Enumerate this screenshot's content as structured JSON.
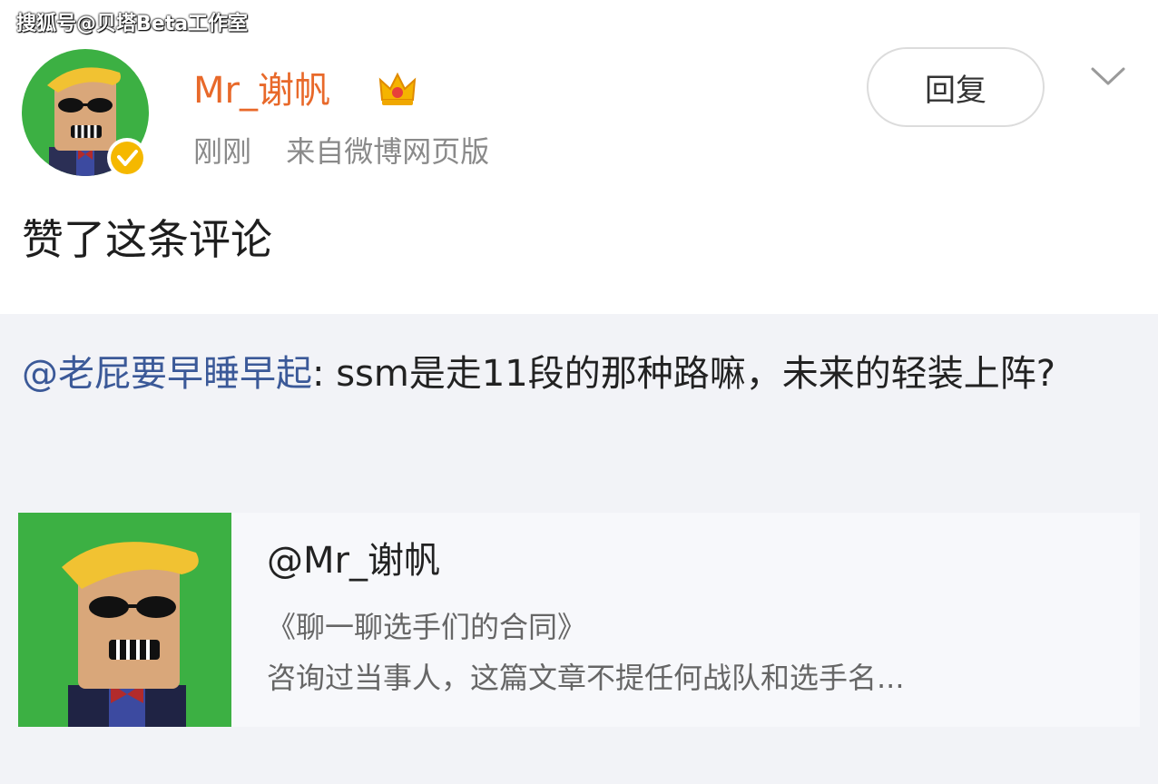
{
  "watermark": "搜狐号@贝塔Beta工作室",
  "post": {
    "username": "Mr_谢帆",
    "time": "刚刚",
    "source": "来自微博网页版",
    "reply_label": "回复",
    "action_text": "赞了这条评论"
  },
  "quote": {
    "mention": "@老屁要早睡早起",
    "text": ": ssm是走11段的那种路嘛，未来的轻装上阵?"
  },
  "card": {
    "title": "@Mr_谢帆",
    "subtitle": "《聊一聊选手们的合同》",
    "description": "咨询过当事人，这篇文章不提任何战队和选手名..."
  },
  "icons": {
    "verified": "verified-badge-icon",
    "crown": "crown-icon",
    "chevron": "chevron-down-icon"
  },
  "colors": {
    "username": "#e8692a",
    "mention": "#3b5998",
    "avatar_bg": "#3cb043",
    "verified": "#f5b800"
  }
}
